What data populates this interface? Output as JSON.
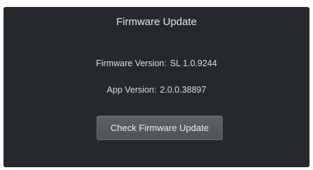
{
  "dialog": {
    "title": "Firmware Update",
    "firmware_version_label": "Firmware Version:",
    "firmware_version_value": "SL 1.0.9244",
    "app_version_label": "App Version:",
    "app_version_value": "2.0.0.38897",
    "check_button_label": "Check Firmware Update"
  },
  "colors": {
    "panel_background": "#25292e",
    "button_background": "#55585c",
    "text": "#e6e8ea"
  }
}
